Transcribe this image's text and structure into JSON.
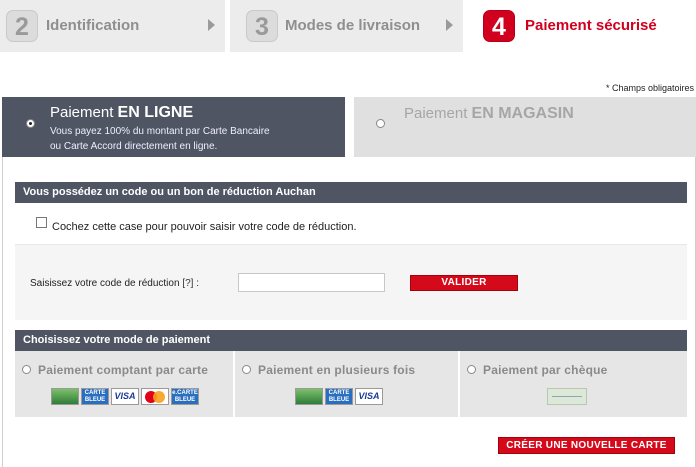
{
  "steps": [
    {
      "number": "2",
      "label": "Identification"
    },
    {
      "number": "3",
      "label": "Modes de livraison"
    },
    {
      "number": "4",
      "label": "Paiement sécurisé"
    }
  ],
  "required_note": "* Champs obligatoires",
  "tabs": {
    "online": {
      "title_prefix": "Paiement",
      "title_strong": "EN LIGNE",
      "desc_line1": "Vous payez 100% du montant par Carte Bancaire",
      "desc_line2": "ou Carte Accord directement en ligne."
    },
    "store": {
      "title_prefix": "Paiement",
      "title_strong": "EN MAGASIN"
    }
  },
  "discount": {
    "heading": "Vous possédez un code ou un bon de réduction Auchan",
    "checkbox_label": "Cochez cette case pour pouvoir saisir votre code de réduction.",
    "code_label": "Saisissez votre code de réduction",
    "help": "[?]",
    "colon": ":",
    "code_value": "",
    "validate_label": "VALIDER"
  },
  "payment_mode": {
    "heading": "Choisissez votre mode de paiement",
    "options": [
      {
        "label": "Paiement comptant par carte",
        "cards": [
          "CB",
          "CARTE BLEUE",
          "VISA",
          "MasterCard",
          "e-CARTE BLEUE"
        ]
      },
      {
        "label": "Paiement en plusieurs fois",
        "cards": [
          "CB",
          "CARTE BLEUE",
          "VISA"
        ]
      },
      {
        "label": "Paiement par chèque",
        "cards": [
          "cheque"
        ]
      }
    ],
    "create_card_label": "CRÉER UNE NOUVELLE CARTE"
  },
  "colors": {
    "brand_red": "#d2001f",
    "tab_dark": "#4f5563",
    "tab_light": "#e0e0e0"
  }
}
